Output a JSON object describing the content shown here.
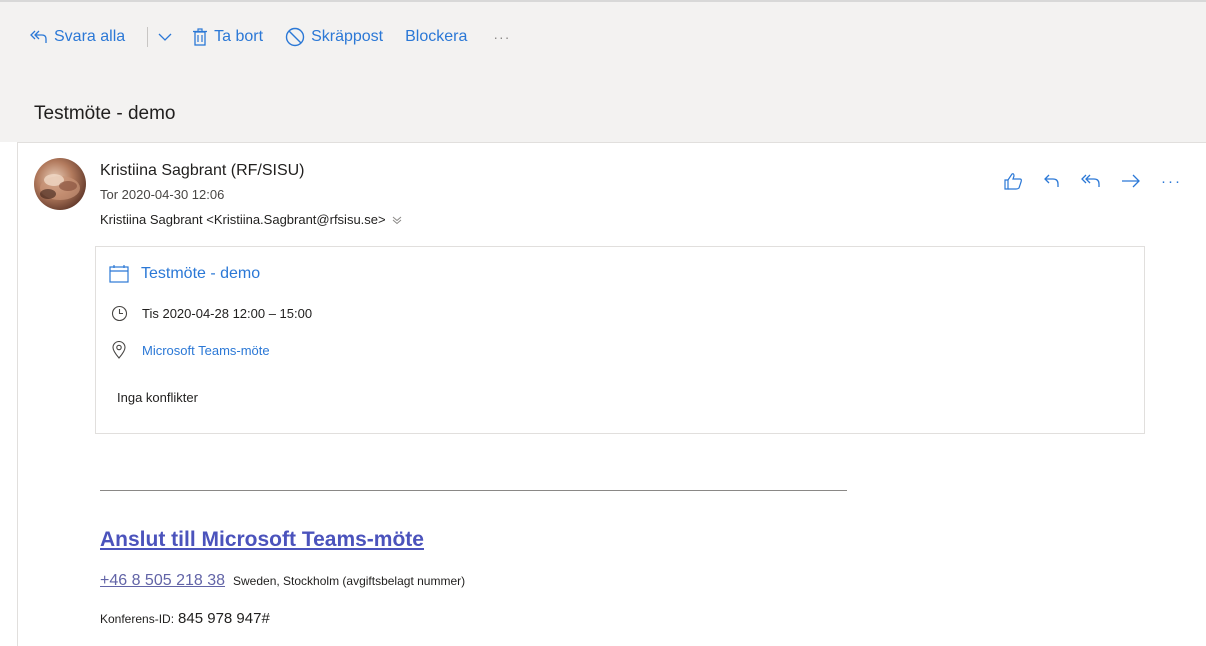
{
  "toolbar": {
    "reply_all": "Svara alla",
    "delete": "Ta bort",
    "junk": "Skräppost",
    "block": "Blockera",
    "more": "···"
  },
  "subject": "Testmöte - demo",
  "message": {
    "sender_name": "Kristiina Sagbrant (RF/SISU)",
    "sent": "Tor 2020-04-30 12:06",
    "to": "Kristiina Sagbrant <Kristiina.Sagbrant@rfsisu.se>",
    "actions_more": "···"
  },
  "invite": {
    "title": "Testmöte - demo",
    "time": "Tis 2020-04-28 12:00 – 15:00",
    "location": "Microsoft Teams-möte",
    "conflicts": "Inga konflikter"
  },
  "body": {
    "join_link": "Anslut till Microsoft Teams-möte",
    "phone": "+46 8 505 218 38",
    "phone_desc": "Sweden, Stockholm (avgiftsbelagt nummer)",
    "conference_label": "Konferens-ID:",
    "conference_id": "845 978 947#"
  },
  "colors": {
    "accent": "#2b78d6",
    "teams_link": "#4b53bc",
    "toolbar_bg": "#f3f2f1"
  }
}
